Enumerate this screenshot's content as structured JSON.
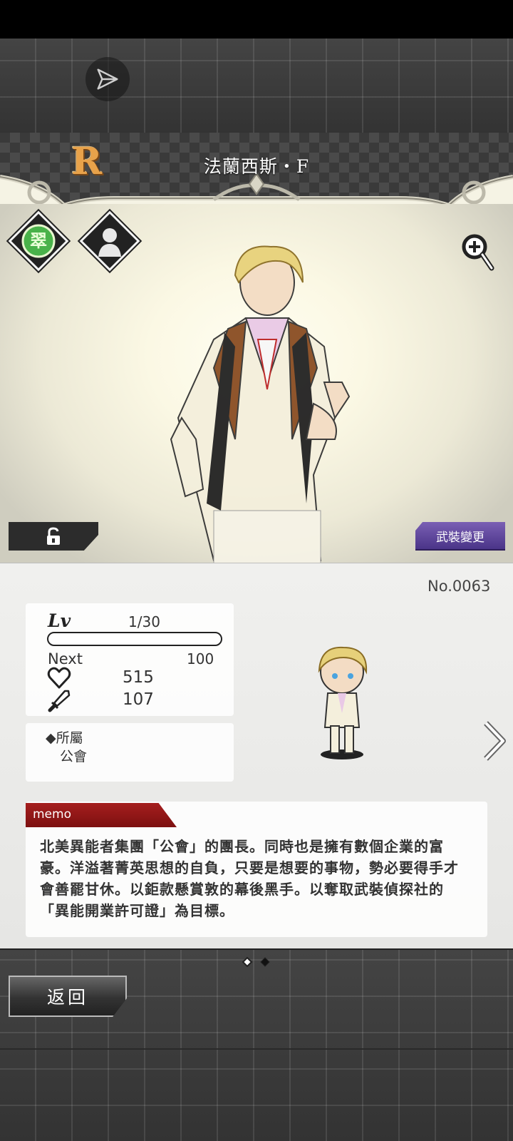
{
  "header": {
    "rarity": "R",
    "character_name": "法蘭西斯・F"
  },
  "badges": {
    "element_glyph": "翠",
    "element_color": "#3aa03a"
  },
  "buttons": {
    "weapon_change": "武裝變更",
    "back": "返回"
  },
  "profile": {
    "number": "No.0063",
    "level_label": "Lv",
    "level": "1/30",
    "exp_fill": 0,
    "next_label": "Next",
    "next_value": "100",
    "hp": "515",
    "attack": "107",
    "affiliation_label": "◆所屬",
    "affiliation_value": "公會"
  },
  "memo": {
    "label": "memo",
    "text": "北美異能者集團「公會」的團長。同時也是擁有數個企業的富豪。洋溢著菁英思想的自負，只要是想要的事物，勢必要得手才會善罷甘休。以鉅款懸賞敦的幕後黑手。以奪取武裝偵探社的「異能開業許可證」為目標。"
  },
  "pagination": {
    "pages": 2,
    "current": 1
  },
  "icons": [
    "share-icon",
    "element-icon",
    "silhouette-icon",
    "zoom-in-icon",
    "unlock-icon",
    "heart-icon",
    "sword-icon",
    "chevron-right-icon"
  ]
}
